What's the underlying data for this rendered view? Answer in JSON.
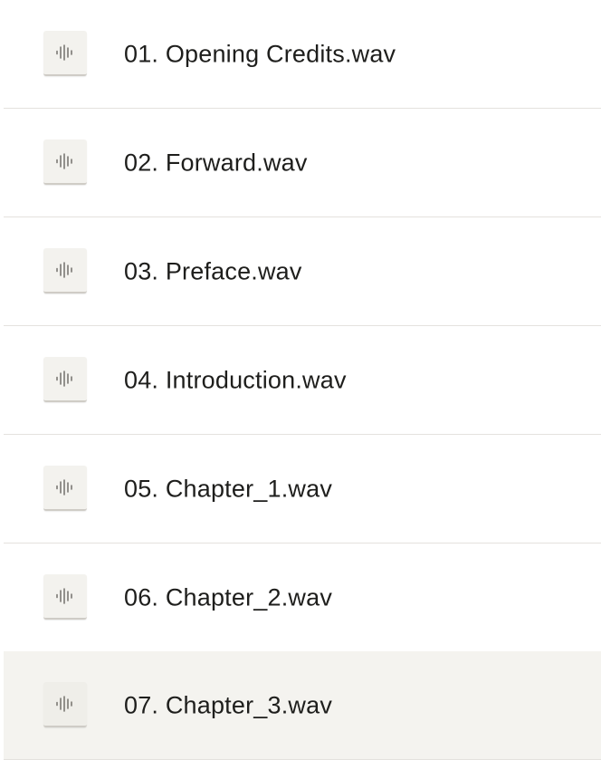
{
  "files": [
    {
      "name": "01. Opening Credits.wav",
      "icon": "audio-waveform-icon",
      "selected": false
    },
    {
      "name": "02. Forward.wav",
      "icon": "audio-waveform-icon",
      "selected": false
    },
    {
      "name": "03. Preface.wav",
      "icon": "audio-waveform-icon",
      "selected": false
    },
    {
      "name": "04. Introduction.wav",
      "icon": "audio-waveform-icon",
      "selected": false
    },
    {
      "name": "05. Chapter_1.wav",
      "icon": "audio-waveform-icon",
      "selected": false
    },
    {
      "name": "06. Chapter_2.wav",
      "icon": "audio-waveform-icon",
      "selected": false
    },
    {
      "name": "07. Chapter_3.wav",
      "icon": "audio-waveform-icon",
      "selected": true
    }
  ],
  "colors": {
    "row_hover": "#f4f3ef",
    "divider": "#e4e2de",
    "icon_stroke": "#7a7873",
    "text": "#1e1e1c"
  }
}
